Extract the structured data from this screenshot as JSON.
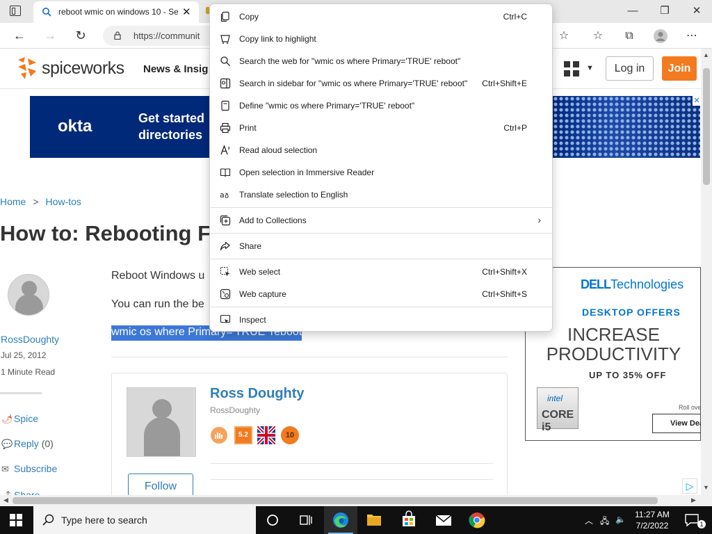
{
  "browser": {
    "tab_title": "reboot wmic on windows 10 - Se",
    "tab_close": "✕",
    "url": "https://communit",
    "window_controls": {
      "minimize": "—",
      "restore": "❐",
      "close": "✕"
    }
  },
  "site": {
    "logo": "spiceworks",
    "nav_link": "News & Insig",
    "login": "Log in",
    "join": "Join"
  },
  "ad_banner": {
    "logo": "okta",
    "line1": "Get started",
    "line2": "directories"
  },
  "breadcrumb": {
    "home": "Home",
    "sep": ">",
    "section": "How-tos"
  },
  "article": {
    "title": "How to: Rebooting F",
    "para1": "Reboot Windows u",
    "para2": "You can run the be",
    "code_selected": "wmic os where Primary='TRUE' reboot"
  },
  "author": {
    "name": "RossDoughty",
    "date": "Jul 25, 2012",
    "read_time": "1 Minute Read",
    "card_name": "Ross Doughty",
    "card_handle": "RossDoughty",
    "follow": "Follow",
    "badge_rank": "5.2",
    "badge_years": "10"
  },
  "side_actions": {
    "spice": "Spice",
    "reply": "Reply",
    "reply_count": "(0)",
    "subscribe": "Subscribe",
    "share": "Share"
  },
  "dell_ad": {
    "logo_brand": "DELL",
    "logo_rest": "Technologies",
    "offers": "DESKTOP OFFERS",
    "big1": "INCREASE",
    "big2": "PRODUCTIVITY",
    "upto": "UP TO 35% OFF",
    "intel": "intel",
    "core": "CORE i5",
    "roll_over": "Roll ove",
    "view_deals": "View Dea"
  },
  "context_menu": {
    "items": [
      {
        "label": "Copy",
        "shortcut": "Ctrl+C",
        "icon": "copy-icon"
      },
      {
        "label": "Copy link to highlight",
        "shortcut": "",
        "icon": "copy-link-icon"
      },
      {
        "label": "Search the web for \"wmic os where Primary='TRUE' reboot\"",
        "shortcut": "",
        "icon": "search-icon"
      },
      {
        "label": "Search in sidebar for \"wmic os where Primary='TRUE' reboot\"",
        "shortcut": "Ctrl+Shift+E",
        "icon": "sidebar-search-icon"
      },
      {
        "label": "Define \"wmic os where Primary='TRUE' reboot\"",
        "shortcut": "",
        "icon": "define-icon"
      },
      {
        "label": "Print",
        "shortcut": "Ctrl+P",
        "icon": "print-icon"
      },
      {
        "label": "Read aloud selection",
        "shortcut": "",
        "icon": "read-aloud-icon"
      },
      {
        "label": "Open selection in Immersive Reader",
        "shortcut": "",
        "icon": "immersive-reader-icon"
      },
      {
        "label": "Translate selection to English",
        "shortcut": "",
        "icon": "translate-icon"
      },
      {
        "label": "Add to Collections",
        "shortcut": "",
        "icon": "collections-icon"
      },
      {
        "label": "Share",
        "shortcut": "",
        "icon": "share-icon"
      },
      {
        "label": "Web select",
        "shortcut": "Ctrl+Shift+X",
        "icon": "web-select-icon"
      },
      {
        "label": "Web capture",
        "shortcut": "Ctrl+Shift+S",
        "icon": "web-capture-icon"
      },
      {
        "label": "Inspect",
        "shortcut": "",
        "icon": "inspect-icon"
      }
    ]
  },
  "taskbar": {
    "search_placeholder": "Type here to search",
    "time": "11:27 AM",
    "date": "7/2/2022",
    "notification_count": "1"
  },
  "colors": {
    "accent_orange": "#f37a1f",
    "link_blue": "#2e7fb8",
    "selection_blue": "#3c78d8",
    "okta_navy": "#00297a",
    "dell_blue": "#0076ce"
  }
}
